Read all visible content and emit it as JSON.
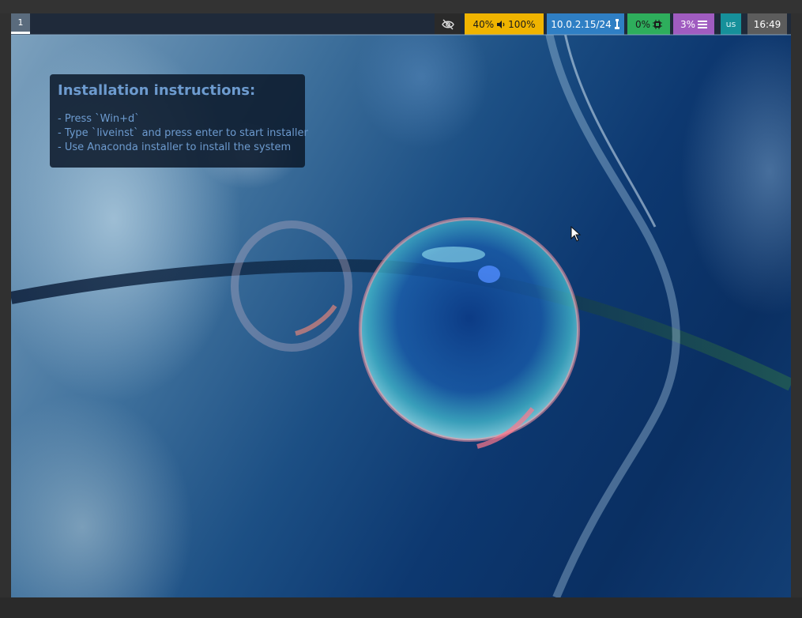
{
  "topbar": {
    "workspace": "1",
    "idle_inhibitor_icon": "eye-slash-icon",
    "audio": {
      "brightness": "40%",
      "volume_icon": "speaker-icon",
      "volume": "100%"
    },
    "network": {
      "address": "10.0.2.15/24",
      "icon": "ethernet-icon"
    },
    "cpu": {
      "value": "0%",
      "icon": "cpu-chip-icon"
    },
    "memory": {
      "value": "3%",
      "icon": "menu-lines-icon"
    },
    "keyboard_layout": "us",
    "clock": "16:49"
  },
  "instructions": {
    "title": "Installation instructions:",
    "lines": [
      "- Press `Win+d`",
      "- Type `liveinst` and press enter to start installer",
      "- Use Anaconda installer to install the system"
    ]
  },
  "colors": {
    "audio_bg": "#f0b400",
    "network_bg": "#2f7fc4",
    "cpu_bg": "#2eae5c",
    "memory_bg": "#a05cc0",
    "lang_bg": "#16909a",
    "clock_bg": "#5c5c5c",
    "instructions_text": "#6d9bcf"
  }
}
